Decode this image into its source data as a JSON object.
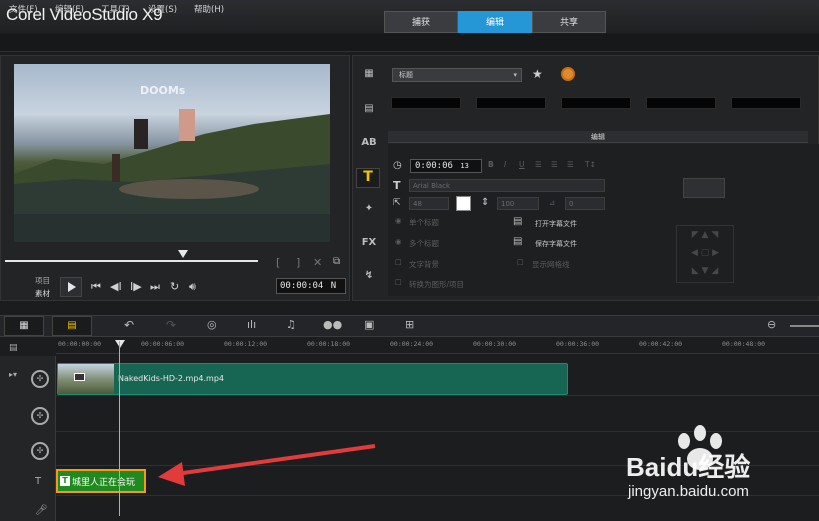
{
  "app": {
    "title": "Corel VideoStudio X9"
  },
  "tabs": [
    {
      "label": "捕获"
    },
    {
      "label": "编辑"
    },
    {
      "label": "共享"
    }
  ],
  "menu": [
    "文件(F)",
    "编辑(E)",
    "工具(T)",
    "设置(S)",
    "帮助(H)"
  ],
  "preview": {
    "mode_project": "项目",
    "mode_clip": "素材",
    "timecode": "00:00:04",
    "timecode_suffix": "N",
    "watermark": "DOOMs"
  },
  "options": {
    "title_select": "标题",
    "edit_tab": "编辑",
    "duration": "0:00:06",
    "duration_frames": "13",
    "font": "Arial Black",
    "font_size": "48",
    "line_spacing": "100",
    "rotation": "0",
    "single_title": "单个标题",
    "multi_title": "多个标题",
    "open_subtitle": "打开字幕文件",
    "save_subtitle": "保存字幕文件",
    "text_background": "文字背景",
    "show_grid": "显示网格线",
    "convert": "转换为图形/项目"
  },
  "timeline": {
    "ticks": [
      "00:00:00:00",
      "00:00:06:00",
      "00:00:12:00",
      "00:00:18:00",
      "00:00:24:00",
      "00:00:30:00",
      "00:00:36:00",
      "00:00:42:00",
      "00:00:48:00"
    ],
    "video_clip": "NakedKids-HD-2.mp4.mp4",
    "title_clip": "城里人正在会玩"
  },
  "watermark": {
    "brand": "Baidu经验",
    "url": "jingyan.baidu.com"
  },
  "colors": {
    "accent": "#2596d6",
    "video_clip": "#176654",
    "title_clip": "#1f8a1f",
    "title_clip_border": "#f39a1b",
    "arrow": "#e23b3b"
  }
}
